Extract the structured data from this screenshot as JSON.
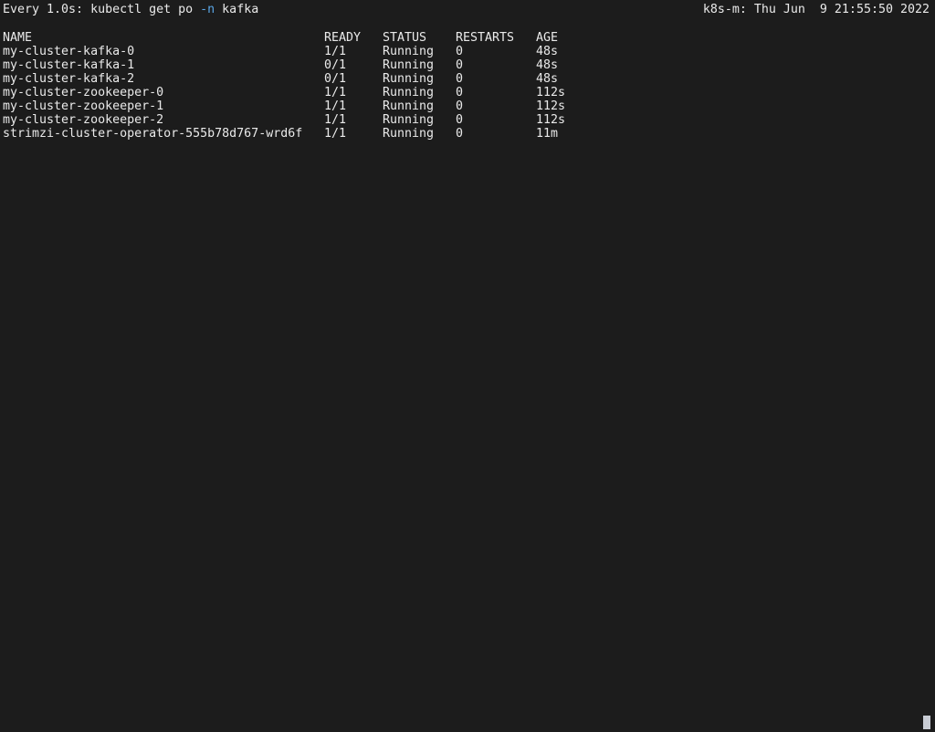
{
  "header": {
    "prefix": "Every 1.0s: kubectl get po ",
    "flag": "-n",
    "suffix": " kafka",
    "host_time": "k8s-m: Thu Jun  9 21:55:50 2022"
  },
  "table": {
    "columns": [
      "NAME",
      "READY",
      "STATUS",
      "RESTARTS",
      "AGE"
    ],
    "rows": [
      [
        "my-cluster-kafka-0",
        "1/1",
        "Running",
        "0",
        "48s"
      ],
      [
        "my-cluster-kafka-1",
        "0/1",
        "Running",
        "0",
        "48s"
      ],
      [
        "my-cluster-kafka-2",
        "0/1",
        "Running",
        "0",
        "48s"
      ],
      [
        "my-cluster-zookeeper-0",
        "1/1",
        "Running",
        "0",
        "112s"
      ],
      [
        "my-cluster-zookeeper-1",
        "1/1",
        "Running",
        "0",
        "112s"
      ],
      [
        "my-cluster-zookeeper-2",
        "1/1",
        "Running",
        "0",
        "112s"
      ],
      [
        "strimzi-cluster-operator-555b78d767-wrd6f",
        "1/1",
        "Running",
        "0",
        "11m"
      ]
    ]
  },
  "colors": {
    "background": "#1c1c1c",
    "text": "#eaeaea",
    "flag": "#5aa6e6",
    "cursor": "#c8ccd4"
  }
}
